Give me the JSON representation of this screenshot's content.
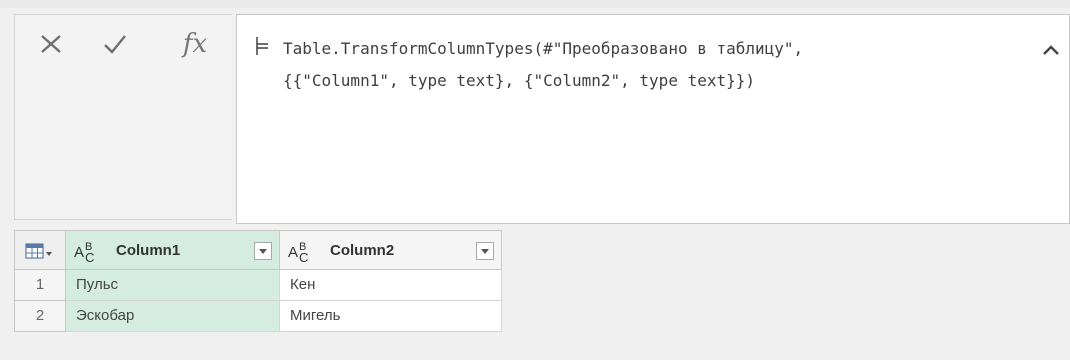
{
  "formula_bar": {
    "cancel_icon": "close-x-icon",
    "commit_icon": "checkmark-icon",
    "fx_label": "fx",
    "formula_line1": "Table.TransformColumnTypes(#\"Преобразовано в таблицу\",",
    "formula_line2": "{{\"Column1\", type text}, {\"Column2\", type text}})",
    "collapse_icon": "chevron-up-icon"
  },
  "table": {
    "corner_icon": "table-menu-icon",
    "columns": [
      {
        "label": "Column1",
        "type_icon": "text-type-icon",
        "selected": true
      },
      {
        "label": "Column2",
        "type_icon": "text-type-icon",
        "selected": false
      }
    ],
    "rows": [
      {
        "num": "1",
        "cells": [
          "Пульс",
          "Кен"
        ]
      },
      {
        "num": "2",
        "cells": [
          "Эскобар",
          "Мигель"
        ]
      }
    ]
  },
  "colors": {
    "selected_column": "#d5ede0",
    "background": "#f0f0f0",
    "editor": "#ffffff",
    "text": "#444444"
  }
}
